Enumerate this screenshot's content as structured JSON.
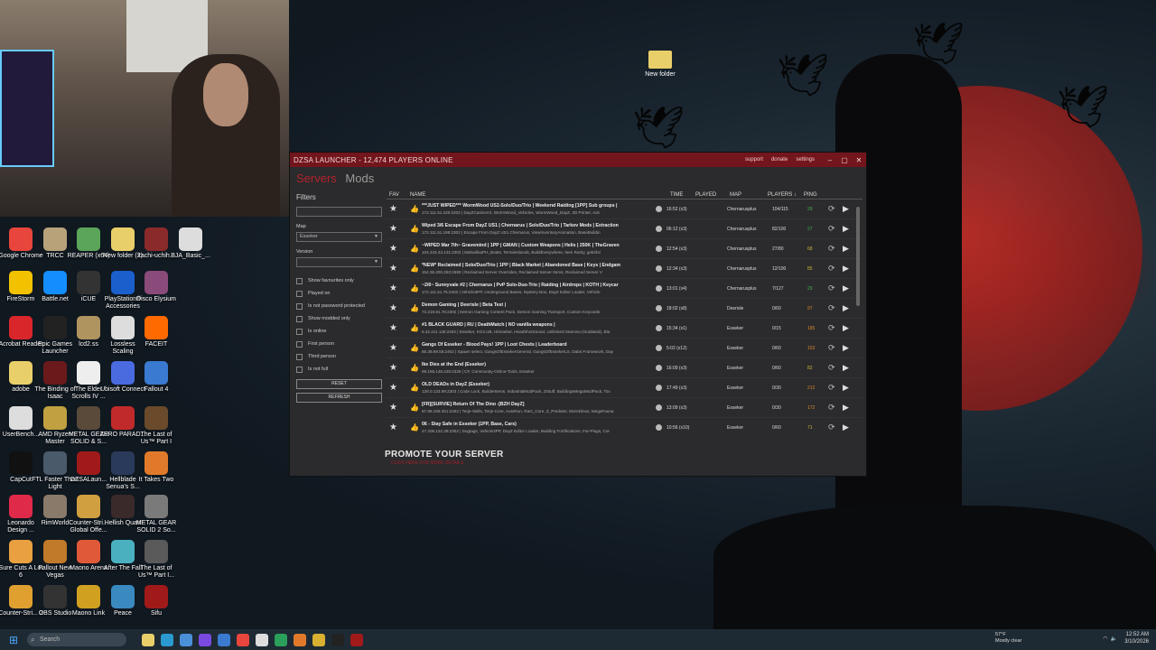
{
  "desktop": {
    "folder_label": "New folder",
    "icons": [
      {
        "label": "Google Chrome",
        "color": "#e8453c"
      },
      {
        "label": "TRCC",
        "color": "#b7a27a"
      },
      {
        "label": "REAPER (x64)",
        "color": "#5aa55a"
      },
      {
        "label": "New folder (2)",
        "color": "#e9cf6a"
      },
      {
        "label": "itachi-uchih...",
        "color": "#8a2a2a"
      },
      {
        "label": "BJA_Basic_...",
        "color": "#ddd"
      },
      {
        "label": "FireStorm",
        "color": "#f2c200"
      },
      {
        "label": "Battle.net",
        "color": "#148eff"
      },
      {
        "label": "iCUE",
        "color": "#333"
      },
      {
        "label": "PlayStation® Accessories",
        "color": "#1a5fcc"
      },
      {
        "label": "Disco Elysium",
        "color": "#8a4a7a"
      },
      {
        "label": "Acrobat Reader",
        "color": "#d9262a"
      },
      {
        "label": "Epic Games Launcher",
        "color": "#222"
      },
      {
        "label": "lcd2.ss",
        "color": "#b09460"
      },
      {
        "label": "Lossless Scaling",
        "color": "#ddd"
      },
      {
        "label": "FACEIT",
        "color": "#ff6a00"
      },
      {
        "label": "adobe",
        "color": "#e9cf6a"
      },
      {
        "label": "The Binding of Isaac",
        "color": "#6a1a1a"
      },
      {
        "label": "The Elder Scrolls IV ...",
        "color": "#eee"
      },
      {
        "label": "Ubisoft Connect",
        "color": "#4a6ae0"
      },
      {
        "label": "Fallout 4",
        "color": "#3a7ad0"
      },
      {
        "label": "UserBench...",
        "color": "#ddd"
      },
      {
        "label": "AMD Ryzen Master",
        "color": "#c0a040"
      },
      {
        "label": "METAL GEAR SOLID & S...",
        "color": "#5a4a3a"
      },
      {
        "label": "ZERO PARAD...",
        "color": "#c02a2a"
      },
      {
        "label": "The Last of Us™ Part I",
        "color": "#6a4a2a"
      },
      {
        "label": "CapCut",
        "color": "#111"
      },
      {
        "label": "FTL Faster Than Light",
        "color": "#4a5a6a"
      },
      {
        "label": "DZSALaun...",
        "color": "#a01a1a"
      },
      {
        "label": "Hellblade Senua's S...",
        "color": "#2a3a5a"
      },
      {
        "label": "It Takes Two",
        "color": "#e07a2a"
      },
      {
        "label": "Leonardo Design ...",
        "color": "#e02a4a"
      },
      {
        "label": "RimWorld",
        "color": "#8a7a6a"
      },
      {
        "label": "Counter-Stri... Global Offe...",
        "color": "#d0a040"
      },
      {
        "label": "Hellish Quart",
        "color": "#3a2a2a"
      },
      {
        "label": "METAL GEAR SOLID 2 So...",
        "color": "#7a7a7a"
      },
      {
        "label": "Sure Cuts A Lot 6",
        "color": "#e9a040"
      },
      {
        "label": "Fallout New Vegas",
        "color": "#c07a2a"
      },
      {
        "label": "Maono Arena",
        "color": "#e05a3a"
      },
      {
        "label": "After The Fall",
        "color": "#4ab0c0"
      },
      {
        "label": "The Last of Us™ Part I...",
        "color": "#5a5a5a"
      },
      {
        "label": "Counter-Stri... 2",
        "color": "#e0a030"
      },
      {
        "label": "OBS Studio",
        "color": "#333"
      },
      {
        "label": "Maono Link",
        "color": "#d0a020"
      },
      {
        "label": "Peace",
        "color": "#3a8ac0"
      },
      {
        "label": "Sifu",
        "color": "#a01a1a"
      }
    ]
  },
  "app": {
    "title": "DZSA LAUNCHER - 12,474 PLAYERS ONLINE",
    "links": [
      "support",
      "donate",
      "settings"
    ],
    "window_buttons": [
      "–",
      "▢",
      "✕"
    ],
    "nav": {
      "servers": "Servers",
      "mods": "Mods"
    },
    "filters": {
      "heading": "Filters",
      "search_value": "",
      "map_label": "Map",
      "map_value": "Esseker",
      "version_label": "Version",
      "version_value": "",
      "checks": [
        "Show favourites only",
        "Played on",
        "Is not password protected",
        "Show modded only",
        "Is online",
        "First person",
        "Third person",
        "Is not full"
      ],
      "reset": "RESET",
      "refresh": "REFRESH"
    },
    "columns": {
      "fav": "FAV",
      "name": "NAME",
      "time": "TIME",
      "played": "PLAYED",
      "map": "MAP",
      "players": "PLAYERS ↓",
      "ping": "PING"
    },
    "rows": [
      {
        "name": "***JUST WIPED*** WormWood US2-Solo/Duo/Trio | Weekend Raiding [1PP] Sub groups |",
        "ip": "172.111.51.230:2402 | DayZCasinoV2, WormWood_Vehicles, WormWood_DayZ, 3D Printer, Adv",
        "time": "16:52 (x3)",
        "map": "Chernarusplus",
        "players": "104/115",
        "ping": "29",
        "pingColor": "#3fb24a"
      },
      {
        "name": "Wiped 3/6 Escape From DayZ US1 | Chernarus | Solo/Duo/Trio | Tarkov Mods | Extraction",
        "ip": "172.111.51.199:2302 | Escape From DayZ US1 Chernarus, ViewInventoryAnimation, BaseBuildin",
        "time": "06:12 (x3)",
        "map": "Chernarusplus",
        "players": "82/100",
        "ping": "27",
        "pingColor": "#3fb24a"
      },
      {
        "name": "~WIPED Mar 7th~ Gravemind | 1PP | GMAN | Custom Weapons | Helis | 250K | TheGraven",
        "ip": "104.243.43.131:2302 | MaharlikaPH_Boats, TerrainIslands, BuildEverywhere, Item Rarity, gebsfol",
        "time": "12:54 (x3)",
        "map": "Chernarusplus",
        "players": "27/80",
        "ping": "68",
        "pingColor": "#c9b43a"
      },
      {
        "name": "*NEW* Reclaimed | Solo/Duo/Trio | 1PP | Black Market | Abandoned Base | Keys | Endgam",
        "ip": "154.36.200.253:2680 | Reclaimed Server Overrides, Reclaimed Server Items, Reclaimed Server V",
        "time": "12:34 (x3)",
        "map": "Chernarusplus",
        "players": "12/100",
        "ping": "85",
        "pingColor": "#c9b43a"
      },
      {
        "name": "~2/6~ Sunnyvale #2 | Chernarus | PvP Solo-Duo-Trio | Raiding | Airdrops | KOTH | Keycar",
        "ip": "172.111.51.75:2402 | Vehicle3PP, Underground Bases, Mystery Box, DayZ Editor Loader, Vehicle",
        "time": "13:01 (x4)",
        "map": "Chernarusplus",
        "players": "7/127",
        "ping": "29",
        "pingColor": "#3fb24a"
      },
      {
        "name": "Demon Gaming | Deerisle | Beta Test |",
        "ip": "72.219.81.78:2302 | Demon Gaming Content Pack, Demon Gaming Transport, Custom Keycards",
        "time": "18:02 (x8)",
        "map": "Deerisle",
        "players": "0/60",
        "ping": "97",
        "pingColor": "#d9862a"
      },
      {
        "name": "#1 BLACK GUARD | RU | DeathMatch | NO vanilla weapons |",
        "ip": "5.42.211.135:2402 | Esseker, KG3.UB, Hitmarker, HeadShotSound, Unlimited Stamina (Outdated), Bla",
        "time": "15:34 (x1)",
        "map": "Esseker",
        "players": "0/15",
        "ping": "185",
        "pingColor": "#d9862a"
      },
      {
        "name": "Gangs Of Esseker - Blood Pays! 1PP | Loot Chests | Leaderboard",
        "ip": "86.38.99.56:2402 | Spawn select, GangsOfEssekerGeneral, GangsOfEssekerLS, Dabs Framework, Day",
        "time": "5:02 (x12)",
        "map": "Esseker",
        "players": "0/60",
        "ping": "153",
        "pingColor": "#d9862a"
      },
      {
        "name": "Ike Dies at the End (Esseker)",
        "ip": "99.155.148.228:2328 | CF, Community-Online-Tools, Esseker",
        "time": "16:09 (x3)",
        "map": "Esseker",
        "players": "0/60",
        "ping": "82",
        "pingColor": "#c9b43a"
      },
      {
        "name": "OLD DEADs in DayZ (Esseker)",
        "ip": "128.0.133.99:2303 | Code Lock, BuilderItems, IndustrialModPack, ZStuff, BuildingsMegaModPack, Tox",
        "time": "17:49 (x3)",
        "map": "Esseker",
        "players": "0/30",
        "ping": "212",
        "pingColor": "#d9862a"
      },
      {
        "name": "[FR][SURVIE] Return Of The Dino -[BZH DayZ]",
        "ip": "87.98.159.251:2402 | Terje-Skills, Terje-Core, AutoRun, RaG_Core, Z_Predator, MoreDinos, MegaFauna",
        "time": "13:09 (x3)",
        "map": "Esseker",
        "players": "0/30",
        "ping": "172",
        "pingColor": "#d9862a"
      },
      {
        "name": "06 - Stay Safe in Esseker (1PP, Base, Cars)",
        "ip": "47.206.132.39:2302 | Dogtags, Vehicle3PP, DayZ Editor Loader, Building Fortifications, Far-Plugs, Cor",
        "time": "10:56 (x10)",
        "map": "Esseker",
        "players": "0/60",
        "ping": "71",
        "pingColor": "#c9b43a"
      }
    ],
    "promo": "PROMOTE YOUR SERVER",
    "promo_sub": "CLICK HERE FOR MORE DETAILS"
  },
  "taskbar": {
    "search_placeholder": "Search",
    "weather_temp": "57°F",
    "weather_desc": "Mostly clear",
    "time": "12:52 AM",
    "date": "3/10/2026"
  }
}
